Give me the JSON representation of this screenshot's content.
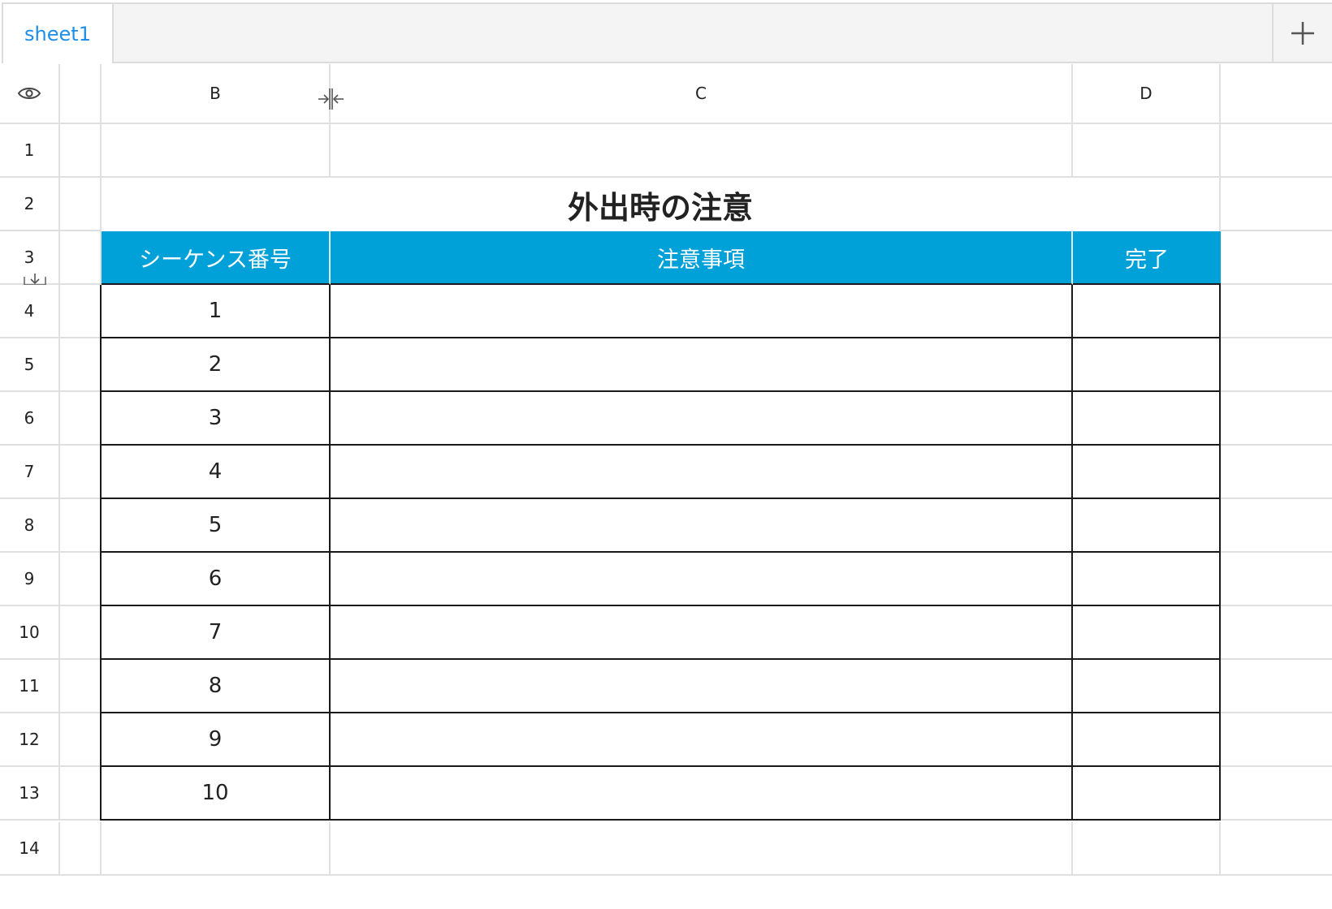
{
  "tabs": {
    "active_sheet": "sheet1",
    "add_icon": "plus-icon"
  },
  "grid": {
    "toggle_icon": "eye-icon",
    "columns": [
      "B",
      "C",
      "D"
    ],
    "rows": [
      "1",
      "2",
      "3",
      "4",
      "5",
      "6",
      "7",
      "8",
      "9",
      "10",
      "11",
      "12",
      "13",
      "14"
    ],
    "title": "外出時の注意",
    "header_fill": "#00a0d9",
    "table_header": {
      "sequence": "シーケンス番号",
      "notes": "注意事項",
      "done": "完了"
    },
    "sequence_numbers": [
      "1",
      "2",
      "3",
      "4",
      "5",
      "6",
      "7",
      "8",
      "9",
      "10"
    ],
    "notes": [
      "",
      "",
      "",
      "",
      "",
      "",
      "",
      "",
      "",
      ""
    ],
    "done": [
      "",
      "",
      "",
      "",
      "",
      "",
      "",
      "",
      "",
      ""
    ]
  }
}
